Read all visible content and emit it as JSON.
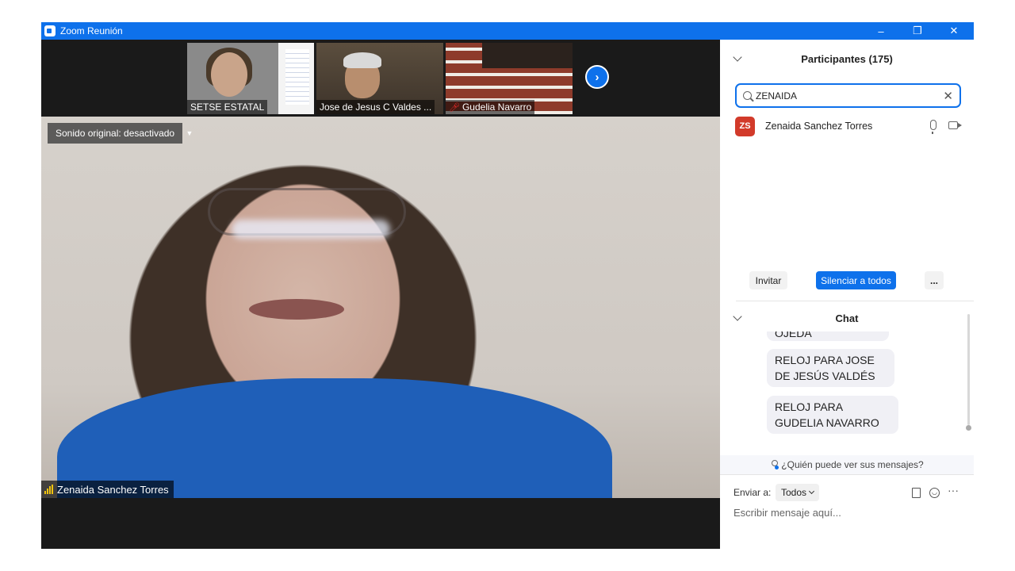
{
  "window": {
    "title": "Zoom Reunión",
    "minimize": "–",
    "restore": "❐",
    "close": "✕"
  },
  "thumbnails": [
    {
      "name": "SETSE ESTATAL",
      "muted": false
    },
    {
      "name": "Jose de Jesus C Valdes ...",
      "muted": false
    },
    {
      "name": "Gudelia Navarro",
      "muted": true
    }
  ],
  "next_page_icon": "chevron-right-icon",
  "main_video": {
    "sound_status": "Sonido original: desactivado",
    "speaker_name": "Zenaida Sanchez Torres",
    "signal_color": "#f1c40f"
  },
  "participants": {
    "header": "Participantes (175)",
    "search_value": "ZENAIDA",
    "results": [
      {
        "initials": "ZS",
        "name": "Zenaida Sanchez Torres",
        "avatar_color": "#d23a2a"
      }
    ],
    "invite_label": "Invitar",
    "mute_all_label": "Silenciar a todos",
    "more_label": "..."
  },
  "chat": {
    "header": "Chat",
    "messages": [
      {
        "text": "OJEDA"
      },
      {
        "text": "RELOJ PARA JOSE DE JESÚS VALDÉS"
      },
      {
        "text": "RELOJ PARA GUDELIA NAVARRO"
      }
    ],
    "who_sees": "¿Quién puede ver sus mensajes?",
    "send_to_label": "Enviar a:",
    "send_to_value": "Todos",
    "more_label": "···",
    "input_placeholder": "Escribir mensaje aquí..."
  },
  "colors": {
    "accent": "#0e71eb",
    "avatar": "#d23a2a"
  }
}
